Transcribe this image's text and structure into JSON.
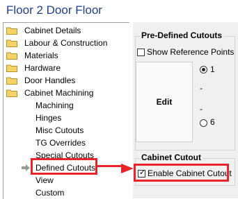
{
  "window": {
    "title": "Floor 2 Door Floor"
  },
  "tree": {
    "top_items": [
      {
        "label": "Cabinet Details"
      },
      {
        "label": "Labour & Construction"
      },
      {
        "label": "Materials"
      },
      {
        "label": "Hardware"
      },
      {
        "label": "Door Handles"
      },
      {
        "label": "Cabinet Machining"
      }
    ],
    "child_items": [
      {
        "label": "Machining"
      },
      {
        "label": "Hinges"
      },
      {
        "label": "Misc Cutouts"
      },
      {
        "label": "TG Overrides"
      },
      {
        "label": "Special Cutouts"
      },
      {
        "label": "Defined Cutouts"
      },
      {
        "label": "View"
      },
      {
        "label": "Custom"
      }
    ]
  },
  "predefined": {
    "group_title": "Pre-Defined Cutouts",
    "show_reference_points_label": "Show Reference Points",
    "edit_label": "Edit",
    "radio_top_label": "1",
    "dash_top": "-",
    "dash_bottom": "-",
    "radio_bottom_label": "6"
  },
  "cabinet_cutout": {
    "group_title": "Cabinet Cutout",
    "enable_label": "Enable Cabinet Cutout",
    "enable_checked": true
  },
  "colors": {
    "highlight": "#e8232a",
    "title": "#1e3f8a"
  }
}
